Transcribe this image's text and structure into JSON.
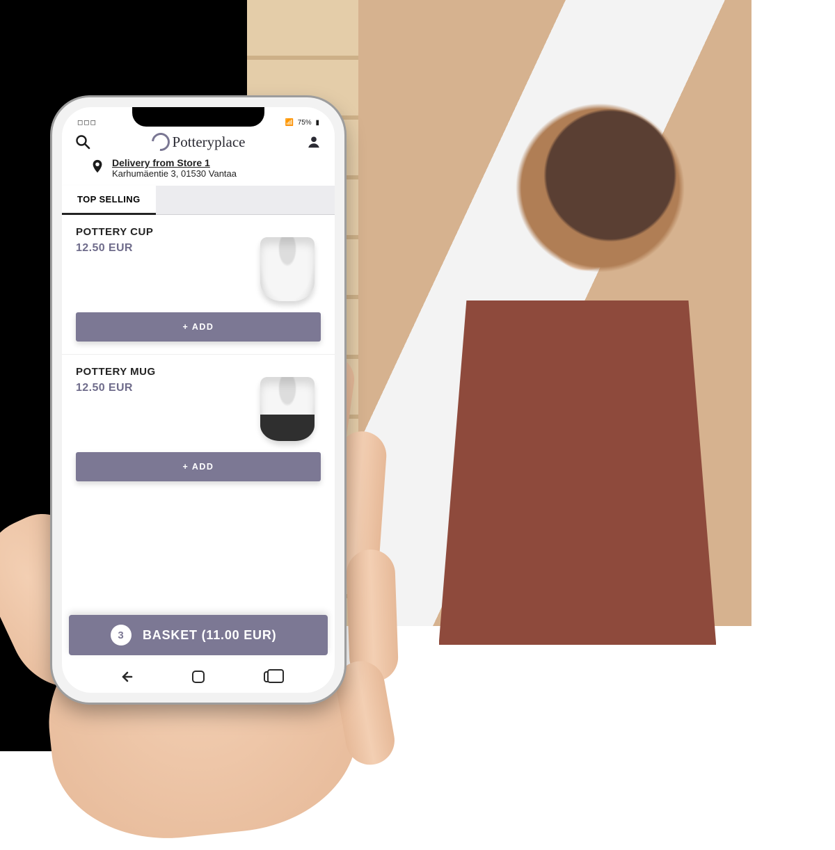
{
  "status": {
    "left": "◻◻◻",
    "battery": "75%"
  },
  "brand": "Potteryplace",
  "delivery": {
    "title": "Delivery from Store 1",
    "address": "Karhumäentie 3, 01530 Vantaa"
  },
  "tabs": {
    "active": "TOP SELLING"
  },
  "products": [
    {
      "name": "POTTERY CUP",
      "price": "12.50 EUR",
      "add": "+ ADD"
    },
    {
      "name": "POTTERY MUG",
      "price": "12.50 EUR",
      "add": "+ ADD"
    }
  ],
  "basket": {
    "count": "3",
    "label": "BASKET (11.00 EUR)"
  },
  "colors": {
    "accent": "#7c7894"
  }
}
